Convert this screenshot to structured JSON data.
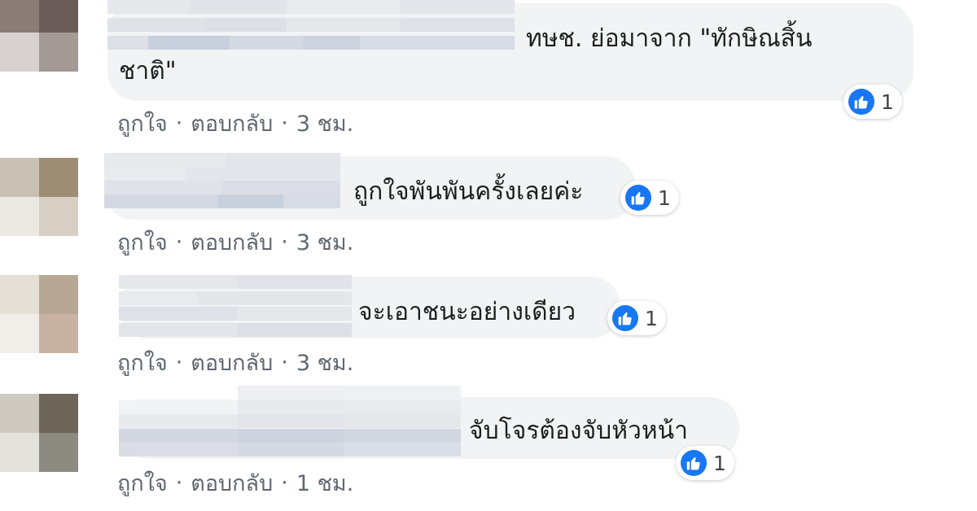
{
  "actions": {
    "like": "ถูกใจ",
    "reply": "ตอบกลับ",
    "sep": "·"
  },
  "colors": {
    "bubble": "#f2f3f5",
    "like_blue": "#1877f2",
    "meta": "#606770",
    "text": "#1c1e21"
  },
  "comments": [
    {
      "author_blurred": true,
      "text_line1": "ทษช. ย่อมาจาก \"ทักษิณสิ้น",
      "text_line2": "ชาติ\"",
      "reactions": {
        "icon": "like-icon",
        "count": "1"
      },
      "time": "3 ชม."
    },
    {
      "author_blurred": true,
      "text": "ถูกใจพันพันครั้งเลยค่ะ",
      "reactions": {
        "icon": "like-icon",
        "count": "1"
      },
      "time": "3 ชม."
    },
    {
      "author_blurred": true,
      "text": "จะเอาชนะอย่างเดียว",
      "reactions": {
        "icon": "like-icon",
        "count": "1"
      },
      "time": "3 ชม."
    },
    {
      "author_blurred": true,
      "text": "จับโจรต้องจับหัวหน้า",
      "reactions": {
        "icon": "like-icon",
        "count": "1"
      },
      "time": "1 ชม."
    }
  ]
}
